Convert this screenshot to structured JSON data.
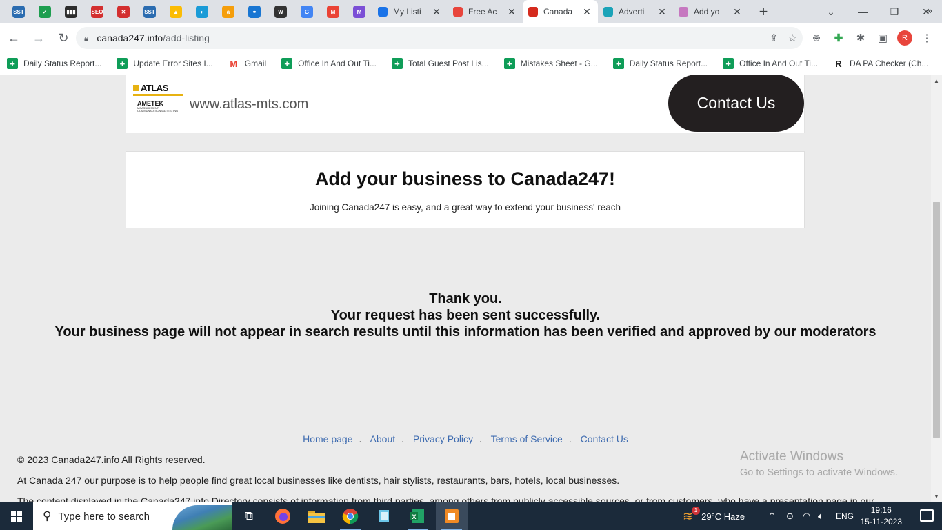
{
  "browser": {
    "pinned_tabs": [
      {
        "name": "sst-favicon",
        "text": "SST",
        "color": "#2b6cb0"
      },
      {
        "name": "checkmark-favicon",
        "text": "✓",
        "color": "#1e9e50"
      },
      {
        "name": "bars-favicon",
        "text": "▮▮▮",
        "color": "#2d2d2d"
      },
      {
        "name": "seo-favicon",
        "text": "SEO",
        "color": "#d32f2f"
      },
      {
        "name": "x-favicon",
        "text": "✕",
        "color": "#d32f2f"
      },
      {
        "name": "sst-favicon-2",
        "text": "SST",
        "color": "#2b6cb0"
      },
      {
        "name": "ads-favicon",
        "text": "▲",
        "color": "#fbbc04"
      },
      {
        "name": "globe-favicon",
        "text": "◐",
        "color": "#1a9bd7"
      },
      {
        "name": "orange-favicon",
        "text": "a",
        "color": "#f59e0b"
      },
      {
        "name": "link-favicon",
        "text": "⚭",
        "color": "#1976d2"
      },
      {
        "name": "wp-favicon",
        "text": "W",
        "color": "#333333"
      },
      {
        "name": "google-favicon",
        "text": "G",
        "color": "#4285f4"
      },
      {
        "name": "gmail-favicon",
        "text": "M",
        "color": "#ea4335"
      },
      {
        "name": "purple-mail-favicon",
        "text": "M",
        "color": "#7b4fd6"
      }
    ],
    "tabs": [
      {
        "title": "My Listi",
        "icon": "location-pin-icon",
        "icon_color": "#1a73e8",
        "active": false
      },
      {
        "title": "Free Ac",
        "icon": "magnifier-icon",
        "icon_color": "#e8453c",
        "active": false
      },
      {
        "title": "Canada",
        "icon": "canada-flag-icon",
        "icon_color": "#d52b1e",
        "active": true
      },
      {
        "title": "Adverti",
        "icon": "y-logo-icon",
        "icon_color": "#1ba3b8",
        "active": false
      },
      {
        "title": "Add yo",
        "icon": "flower-icon",
        "icon_color": "#c678c0",
        "active": false
      }
    ],
    "url_domain": "canada247.info",
    "url_path": "/add-listing",
    "bookmarks": [
      {
        "label": "Daily Status Report..."
      },
      {
        "label": "Update Error Sites I..."
      },
      {
        "label": "Gmail"
      },
      {
        "label": "Office In And Out Ti..."
      },
      {
        "label": "Total Guest Post Lis..."
      },
      {
        "label": "Mistakes Sheet - G..."
      },
      {
        "label": "Daily Status Report..."
      },
      {
        "label": "Office In And Out Ti..."
      },
      {
        "label": "DA PA Checker (Ch..."
      }
    ],
    "profile_initial": "R"
  },
  "ad": {
    "logo_top": "ATLAS",
    "logo_bottom": "AMETEK",
    "logo_sub": "MEASUREMENT COMMUNICATIONS & TESTING",
    "site": "www.atlas-mts.com",
    "button": "Contact Us"
  },
  "add_business": {
    "title": "Add your business to Canada247!",
    "subtitle": "Joining Canada247 is easy, and a great way to extend your business' reach"
  },
  "thanks": {
    "line1": "Thank you.",
    "line2": "Your request has been sent successfully.",
    "line3": "Your business page will not appear in search results until this information has been verified and approved by our moderators"
  },
  "footer": {
    "links": [
      "Home page",
      "About",
      "Privacy Policy",
      "Terms of Service",
      "Contact Us"
    ],
    "copyright": "© 2023 Canada247.info All Rights reserved.",
    "purpose": "At Canada 247 our purpose is to help people find great local businesses like dentists, hair stylists, restaurants, bars, hotels, local businesses.",
    "disclaimer": "The content displayed in the Canada247.info Directory consists of information from third parties, among others from publicly accessible sources, or from customers, who have a presentation page in our"
  },
  "watermark": {
    "title": "Activate Windows",
    "subtitle": "Go to Settings to activate Windows."
  },
  "taskbar": {
    "search_placeholder": "Type here to search",
    "weather": "29°C  Haze",
    "weather_badge": "1",
    "language": "ENG",
    "time": "19:16",
    "date": "15-11-2023"
  }
}
